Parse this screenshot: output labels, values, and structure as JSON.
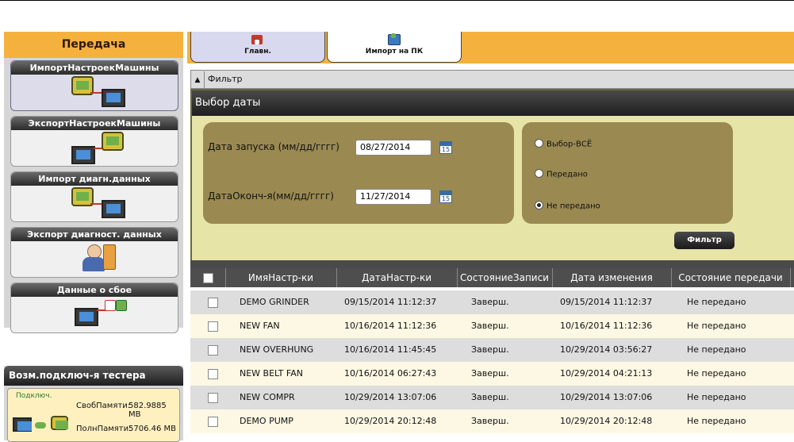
{
  "sidebar": {
    "title": "Передача",
    "items": [
      {
        "label": "ИмпортНастроекМашины",
        "icon": "device-to-pc-icon"
      },
      {
        "label": "ЭкспортНастроекМашины",
        "icon": "pc-to-device-icon"
      },
      {
        "label": "Импорт диагн.данных",
        "icon": "device-to-pc-data-icon"
      },
      {
        "label": "Экспорт диагност. данных",
        "icon": "person-database-icon"
      },
      {
        "label": "Данные о сбое",
        "icon": "pc-error-icon"
      }
    ]
  },
  "tester": {
    "title": "Возм.подключ-я тестера",
    "status": "Подключ.",
    "free_label": "СвобПамяти:",
    "free_value": "582.9885 MB",
    "total_label": "ПолнПамяти:",
    "total_value": "5706.46 MB"
  },
  "tabs": [
    {
      "label": "Главн.",
      "icon": "home-icon"
    },
    {
      "label": "Импорт на ПК",
      "icon": "import-pc-icon"
    }
  ],
  "filter": {
    "header": "Фильтр",
    "panel_title": "Выбор даты",
    "start_label": "Дата запуска (мм/дд/гггг)",
    "start_value": "08/27/2014",
    "end_label": "ДатаОконч-я(мм/дд/гггг)",
    "end_value": "11/27/2014",
    "calendar_text": "15",
    "radios": [
      {
        "label": "Выбор-ВСЁ",
        "selected": false
      },
      {
        "label": "Передано",
        "selected": false
      },
      {
        "label": "Не передано",
        "selected": true
      }
    ],
    "button": "Фильтр"
  },
  "table": {
    "columns": [
      "ИмяНастр-ки",
      "ДатаНастр-ки",
      "СостояниеЗаписи",
      "Дата изменения",
      "Состояние передачи"
    ],
    "rows": [
      [
        "DEMO GRINDER",
        "09/15/2014 11:12:37",
        "Заверш.",
        "09/15/2014 11:12:37",
        "Не передано"
      ],
      [
        "NEW FAN",
        "10/16/2014 11:12:36",
        "Заверш.",
        "10/16/2014 11:12:36",
        "Не передано"
      ],
      [
        "NEW OVERHUNG",
        "10/16/2014 11:45:45",
        "Заверш.",
        "10/29/2014 03:56:27",
        "Не передано"
      ],
      [
        "NEW BELT FAN",
        "10/16/2014 06:27:43",
        "Заверш.",
        "10/29/2014 04:21:13",
        "Не передано"
      ],
      [
        "NEW COMPR",
        "10/29/2014 13:07:06",
        "Заверш.",
        "10/29/2014 13:07:06",
        "Не передано"
      ],
      [
        "DEMO PUMP",
        "10/29/2014 20:12:48",
        "Заверш.",
        "10/29/2014 20:12:48",
        "Не передано"
      ]
    ]
  },
  "colors": {
    "accent": "#f4b13e",
    "panel": "#e7e4a8",
    "inner": "#9a8a52",
    "header": "#4e4e4e"
  }
}
